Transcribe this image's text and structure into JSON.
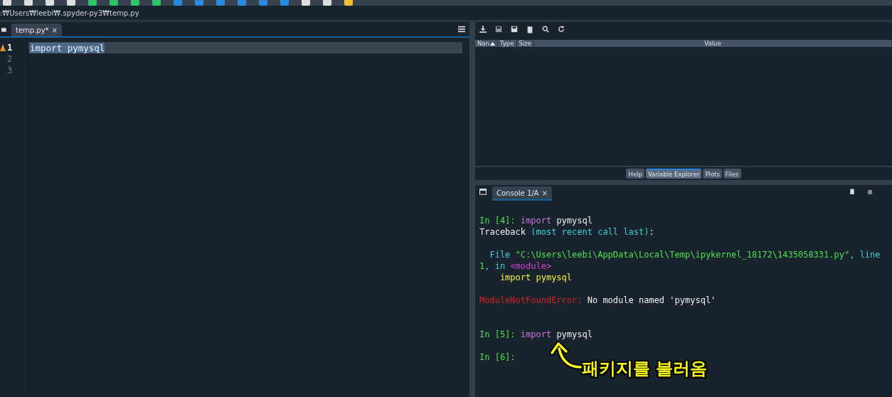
{
  "path": ":₩Users₩leebi₩.spyder-py3₩temp.py",
  "editor": {
    "tabs": [
      {
        "label": "temp.py*",
        "close": "×",
        "selected": true
      }
    ],
    "lines": [
      {
        "number": "1",
        "code": "import pymysql",
        "warning": true,
        "current": true
      },
      {
        "number": "2",
        "warning": false,
        "current": false
      },
      {
        "number": "3",
        "warning": false,
        "current": false
      }
    ]
  },
  "variable_explorer": {
    "columns": [
      {
        "label": "Nan",
        "sorted": true
      },
      {
        "label": "Type",
        "sorted": false
      },
      {
        "label": "Size",
        "sorted": false
      },
      {
        "label": "Value",
        "sorted": false
      }
    ]
  },
  "pane_tabs": [
    {
      "label": "Help",
      "selected": false
    },
    {
      "label": "Variable Explorer",
      "selected": true
    },
    {
      "label": "Plots",
      "selected": false
    },
    {
      "label": "Files",
      "selected": false
    }
  ],
  "console": {
    "tabs": [
      {
        "label": "Console 1/A",
        "close": "×",
        "selected": true
      }
    ],
    "lines": [
      {
        "kind": "code",
        "segments": [
          {
            "kind": "prompt",
            "text": "In [4]: "
          },
          {
            "kind": "keyword",
            "text": "import"
          },
          {
            "kind": "plain",
            "text": " pymysql"
          }
        ]
      },
      {
        "kind": "code",
        "segments": [
          {
            "kind": "plain",
            "text": "Traceback "
          },
          {
            "kind": "info",
            "text": "(most recent call last)"
          },
          {
            "kind": "plain",
            "text": ":"
          }
        ]
      },
      {
        "kind": "blank"
      },
      {
        "kind": "code",
        "segments": [
          {
            "kind": "info",
            "text": "  File "
          },
          {
            "kind": "string",
            "text": "\"C:\\Users\\leebi\\AppData\\Local\\Temp\\ipykernel_18172\\1435058331.py\""
          },
          {
            "kind": "info",
            "text": ", line"
          }
        ]
      },
      {
        "kind": "code",
        "segments": [
          {
            "kind": "string",
            "text": "1"
          },
          {
            "kind": "info",
            "text": ", in "
          },
          {
            "kind": "module",
            "text": "<module>"
          }
        ]
      },
      {
        "kind": "code",
        "segments": [
          {
            "kind": "source",
            "text": "    import pymysql"
          }
        ]
      },
      {
        "kind": "blank"
      },
      {
        "kind": "code",
        "segments": [
          {
            "kind": "error",
            "text": "ModuleNotFoundError:"
          },
          {
            "kind": "plain",
            "text": " No module named 'pymysql'"
          }
        ]
      },
      {
        "kind": "blank"
      },
      {
        "kind": "blank"
      },
      {
        "kind": "code",
        "segments": [
          {
            "kind": "prompt",
            "text": "In [5]: "
          },
          {
            "kind": "keyword",
            "text": "import"
          },
          {
            "kind": "plain",
            "text": " pymysql"
          }
        ]
      },
      {
        "kind": "blank"
      },
      {
        "kind": "code",
        "segments": [
          {
            "kind": "prompt",
            "text": "In [6]:"
          }
        ]
      }
    ]
  },
  "annotation": {
    "text": "패키지를 불러옴"
  }
}
